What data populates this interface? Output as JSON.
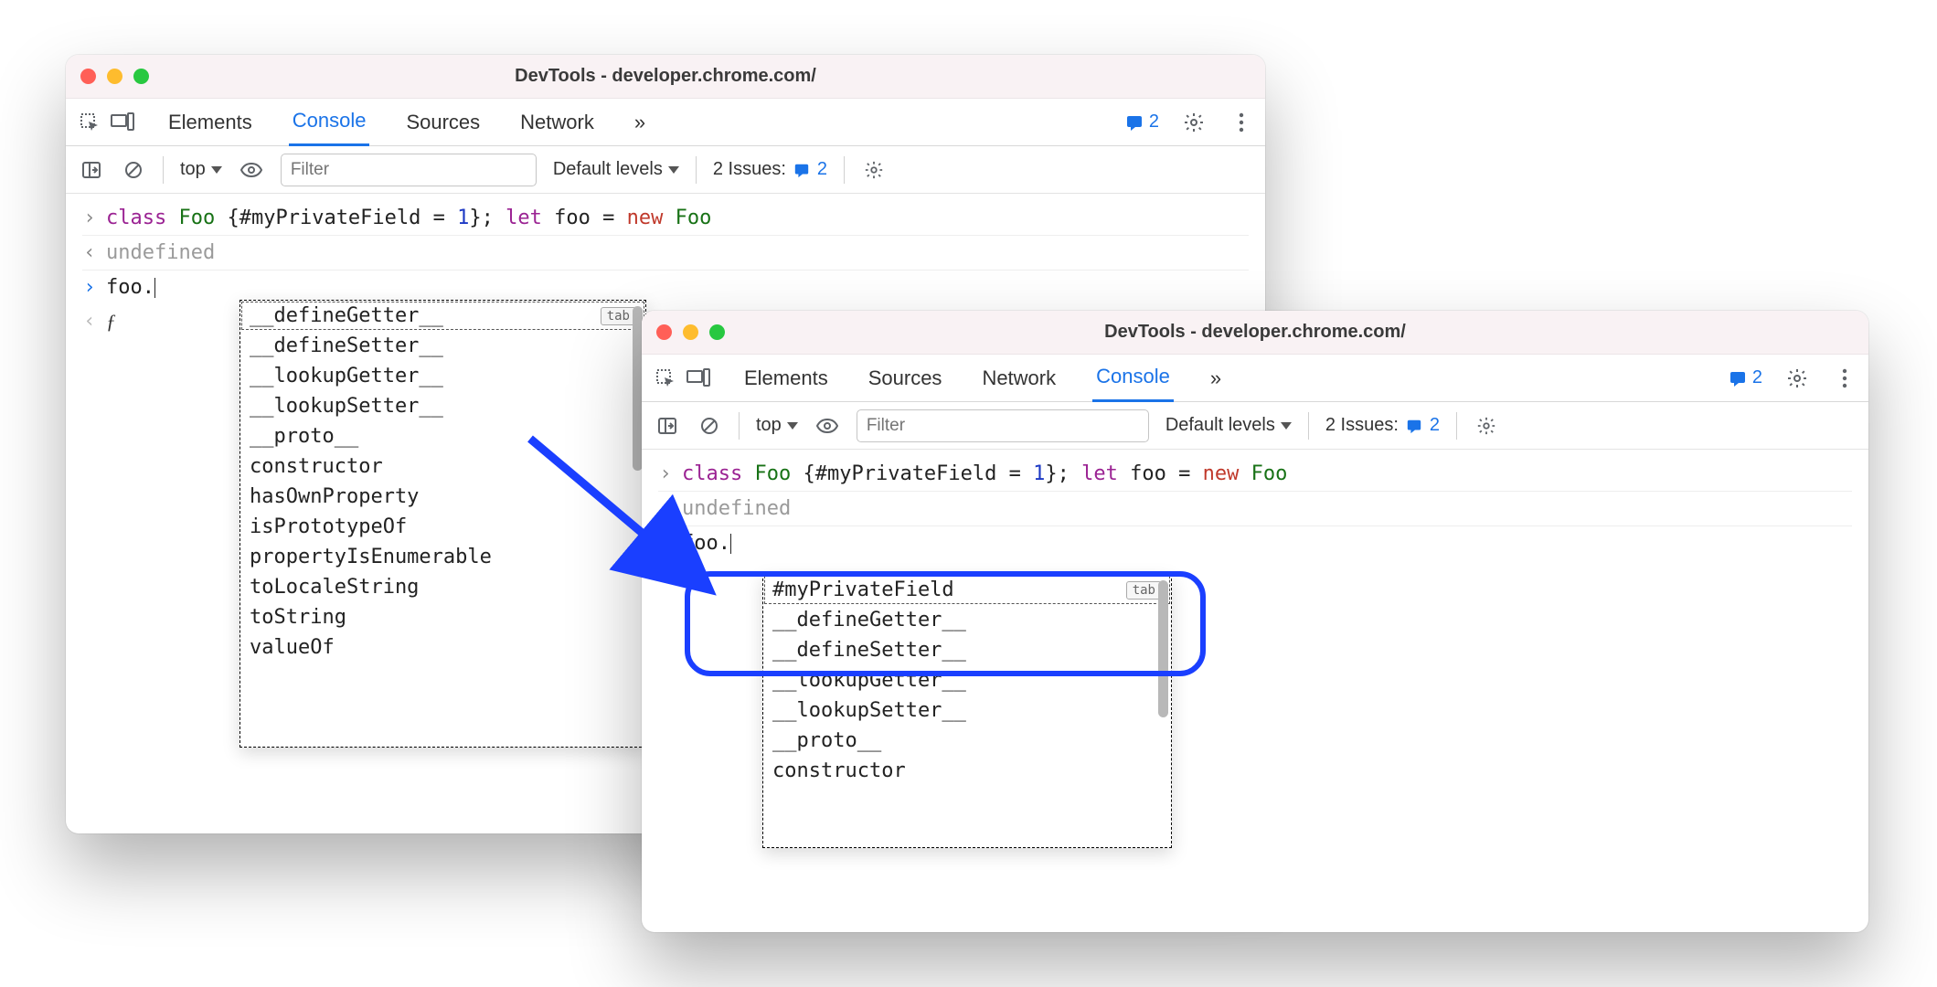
{
  "window1": {
    "title": "DevTools - developer.chrome.com/",
    "tabs": [
      "Elements",
      "Console",
      "Sources",
      "Network"
    ],
    "activeTab": "Console",
    "overflow": "»",
    "issuesCount": "2",
    "sub": {
      "context": "top",
      "filterPlaceholder": "Filter",
      "levels": "Default levels",
      "issuesLabel": "2 Issues:",
      "issuesBadge": "2"
    },
    "console": {
      "line1_tokens": [
        "class",
        " ",
        "Foo",
        " ",
        "{#myPrivateField = ",
        "1",
        "}; ",
        "let",
        " foo = ",
        "new",
        " ",
        "Foo"
      ],
      "undefined": "undefined",
      "input": "foo.",
      "fnGlyph": "ƒ",
      "tabKey": "tab",
      "autocomplete": [
        "__defineGetter__",
        "__defineSetter__",
        "__lookupGetter__",
        "__lookupSetter__",
        "__proto__",
        "constructor",
        "hasOwnProperty",
        "isPrototypeOf",
        "propertyIsEnumerable",
        "toLocaleString",
        "toString",
        "valueOf"
      ]
    }
  },
  "window2": {
    "title": "DevTools - developer.chrome.com/",
    "tabs": [
      "Elements",
      "Sources",
      "Network",
      "Console"
    ],
    "activeTab": "Console",
    "overflow": "»",
    "issuesCount": "2",
    "sub": {
      "context": "top",
      "filterPlaceholder": "Filter",
      "levels": "Default levels",
      "issuesLabel": "2 Issues:",
      "issuesBadge": "2"
    },
    "console": {
      "line1_tokens": [
        "class",
        " ",
        "Foo",
        " ",
        "{#myPrivateField = ",
        "1",
        "}; ",
        "let",
        " foo = ",
        "new",
        " ",
        "Foo"
      ],
      "undefined": "undefined",
      "input": "foo.",
      "tabKey": "tab",
      "autocomplete": [
        "#myPrivateField",
        "__defineGetter__",
        "__defineSetter__",
        "__lookupGetter__",
        "__lookupSetter__",
        "__proto__",
        "constructor"
      ]
    }
  }
}
